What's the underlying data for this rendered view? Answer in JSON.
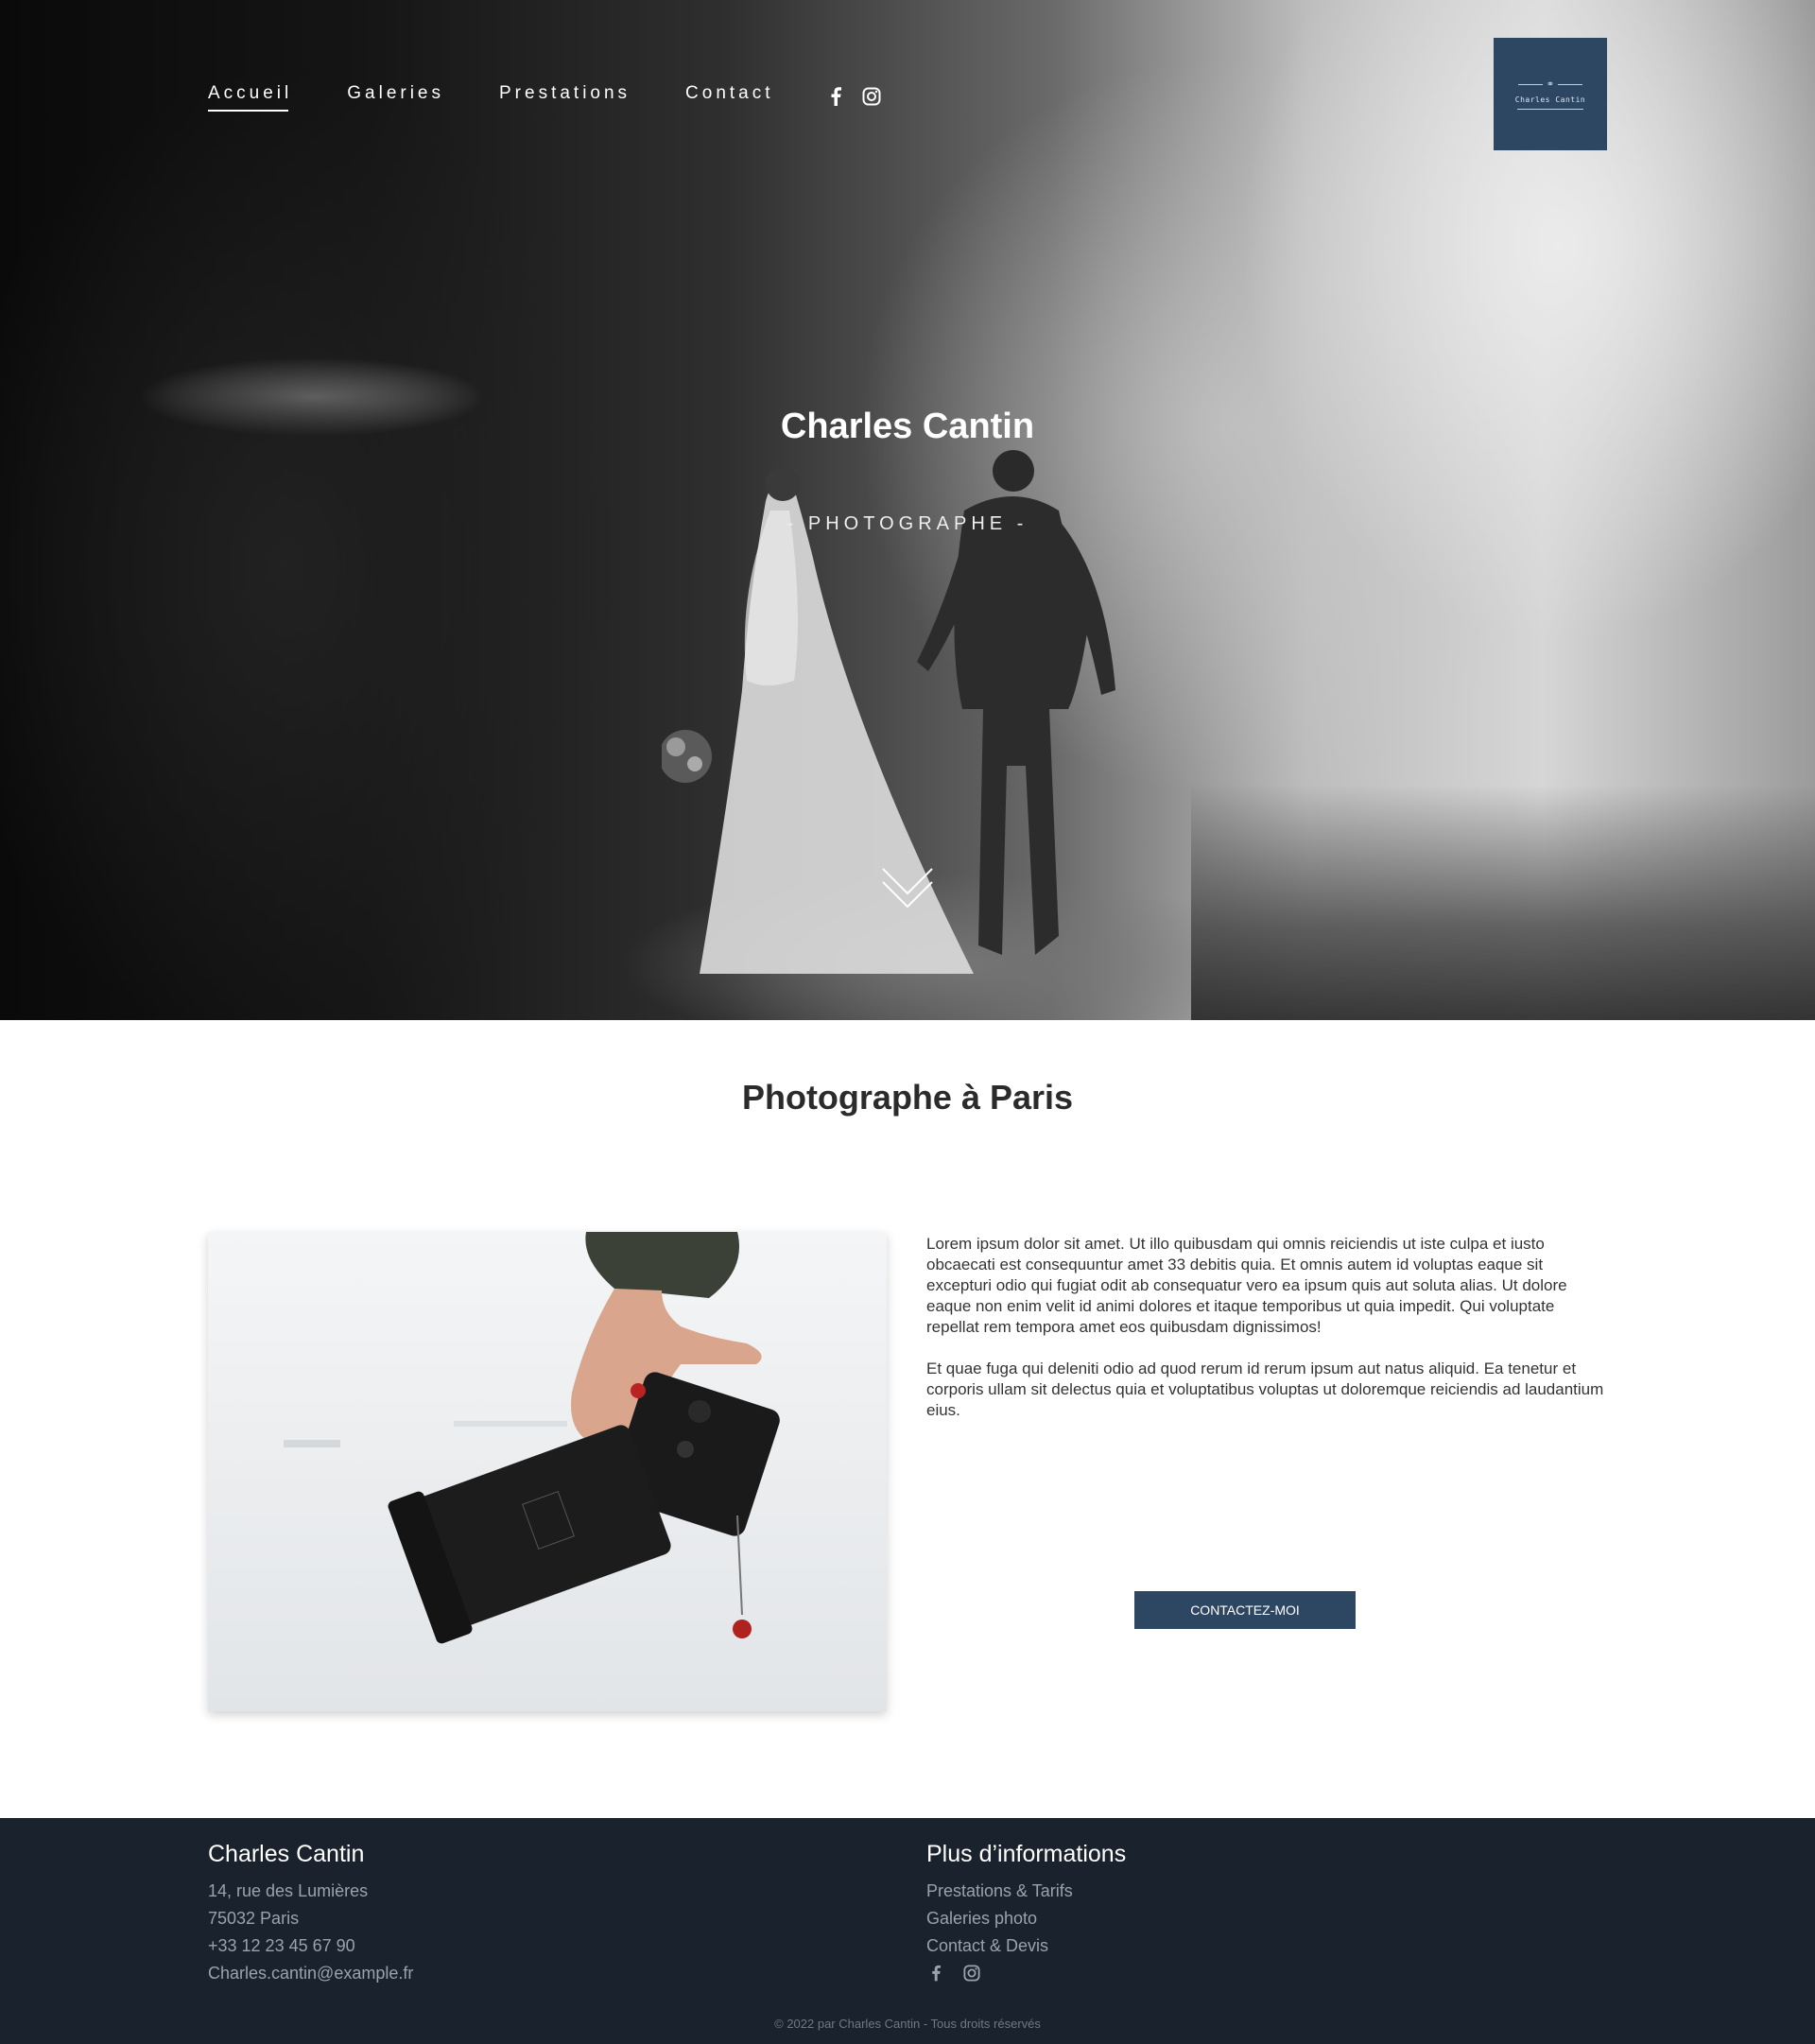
{
  "nav": {
    "items": [
      {
        "label": "Accueil",
        "active": true
      },
      {
        "label": "Galeries",
        "active": false
      },
      {
        "label": "Prestations",
        "active": false
      },
      {
        "label": "Contact",
        "active": false
      }
    ],
    "social_icons": [
      "facebook-icon",
      "instagram-icon"
    ]
  },
  "logo": {
    "text": "Charles Cantin",
    "background": "#2d4763"
  },
  "hero": {
    "title": "Charles Cantin",
    "subtitle": "- PHOTOGRAPHE -",
    "scroll_icon": "chevron-down-icon"
  },
  "about": {
    "title": "Photographe à Paris",
    "paragraphs": [
      "Lorem ipsum dolor sit amet. Ut illo quibusdam qui omnis reiciendis ut iste culpa et iusto obcaecati est consequuntur amet 33 debitis quia. Et omnis autem id voluptas eaque sit excepturi odio qui fugiat odit ab consequatur vero ea ipsum quis aut soluta alias. Ut dolore eaque non enim velit id animi dolores et itaque temporibus ut quia impedit. Qui voluptate repellat rem tempora amet eos quibusdam dignissimos!",
      "Et quae fuga qui deleniti odio ad quod rerum id rerum ipsum aut natus aliquid. Ea tenetur et corporis ullam sit delectus quia et voluptatibus voluptas ut doloremque reiciendis ad laudantium eius."
    ],
    "cta_label": "CONTACTEZ-MOI"
  },
  "footer": {
    "left": {
      "title": "Charles Cantin",
      "lines": [
        "14, rue des Lumières",
        "75032 Paris",
        "+33 12 23 45 67 90",
        "Charles.cantin@example.fr"
      ]
    },
    "right": {
      "title": "Plus d’informations",
      "links": [
        "Prestations & Tarifs",
        "Galeries photo",
        "Contact & Devis"
      ],
      "social_icons": [
        "facebook-icon",
        "instagram-icon"
      ]
    },
    "copyright": "© 2022 par Charles Cantin - Tous droits réservés",
    "background": "#19222d"
  }
}
